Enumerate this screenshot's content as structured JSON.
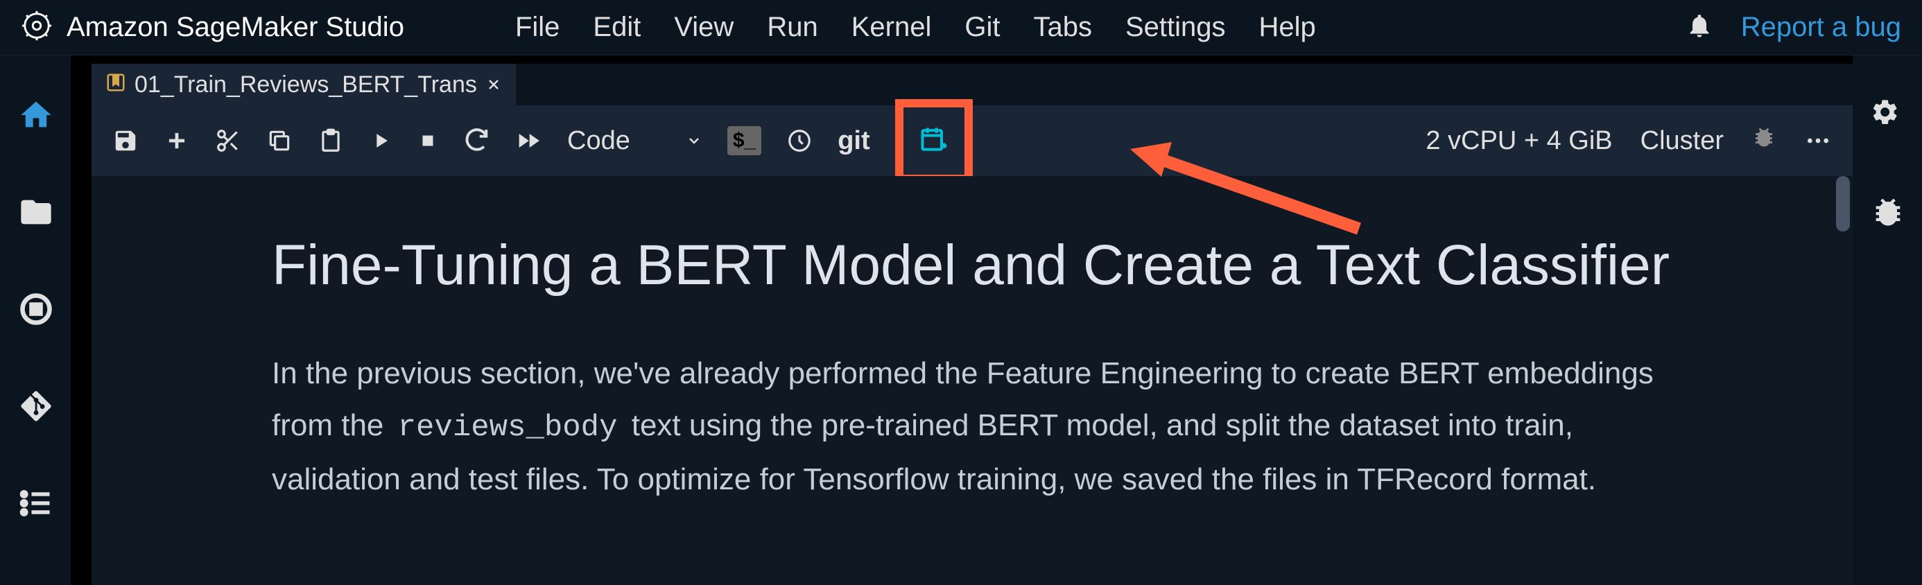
{
  "header": {
    "title": "Amazon SageMaker Studio",
    "menu": [
      "File",
      "Edit",
      "View",
      "Run",
      "Kernel",
      "Git",
      "Tabs",
      "Settings",
      "Help"
    ],
    "report_bug": "Report a bug"
  },
  "tab": {
    "name": "01_Train_Reviews_BERT_Trans"
  },
  "toolbar": {
    "cell_type": "Code",
    "git_label": "git",
    "compute": "2 vCPU + 4 GiB",
    "cluster": "Cluster"
  },
  "content": {
    "heading": "Fine-Tuning a BERT Model and Create a Text Classifier",
    "para_1": "In the previous section, we've already performed the Feature Engineering to create BERT embeddings from the ",
    "code_1": "reviews_body",
    "para_2": " text using the pre-trained BERT model, and split the dataset into train, validation and test files. To optimize for Tensorflow training, we saved the files in TFRecord format."
  },
  "highlight": {
    "color": "#ff5e3a"
  }
}
